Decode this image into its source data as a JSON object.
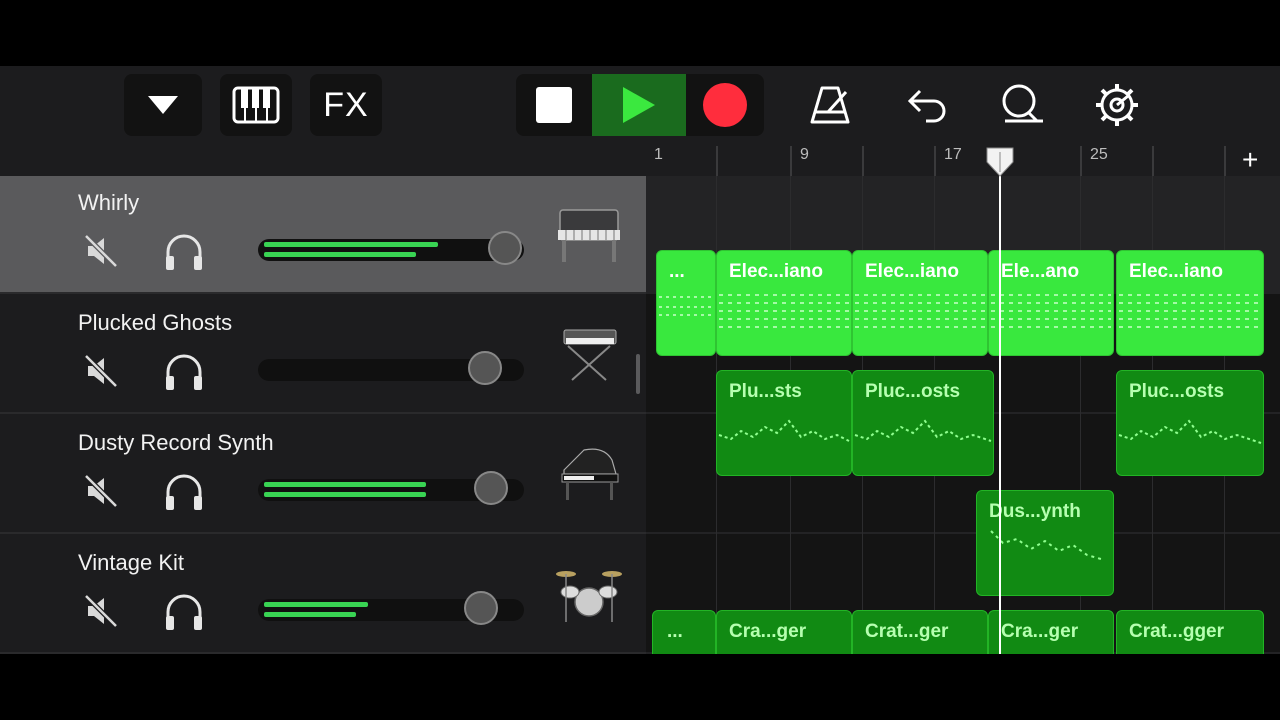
{
  "toolbar": {
    "fx_label": "FX",
    "icons": [
      "dropdown-triangle-icon",
      "piano-keyboard-icon",
      "stop-icon",
      "play-icon",
      "record-icon",
      "metronome-icon",
      "undo-icon",
      "loop-icon",
      "settings-gear-icon"
    ]
  },
  "ruler": {
    "bars": [
      "1",
      "9",
      "17",
      "25"
    ],
    "add_label": "+"
  },
  "tracks": [
    {
      "name": "Whirly",
      "instrument": "electric-piano",
      "volume": 0.66,
      "selected": true
    },
    {
      "name": "Plucked Ghosts",
      "instrument": "synth-keyboard",
      "volume": 0.0
    },
    {
      "name": "Dusty Record Synth",
      "instrument": "grand-piano",
      "volume": 0.68
    },
    {
      "name": "Vintage Kit",
      "instrument": "drum-kit",
      "volume": 0.42
    }
  ],
  "regions": {
    "whirly": [
      "...",
      "Elec...iano",
      "Elec...iano",
      "Ele...ano",
      "Elec...iano"
    ],
    "plucked": [
      "Plu...sts",
      "Pluc...osts",
      "Pluc...osts"
    ],
    "dusty": [
      "Dus...ynth"
    ],
    "drums": [
      "...",
      "Cra...ger",
      "Crat...ger",
      "Cra...ger",
      "Crat...gger"
    ]
  },
  "colors": {
    "region_bright": "#39e83e",
    "region_dim": "#118a13",
    "transport_play_bg": "#1a6b1e",
    "record": "#ff2d3d"
  }
}
